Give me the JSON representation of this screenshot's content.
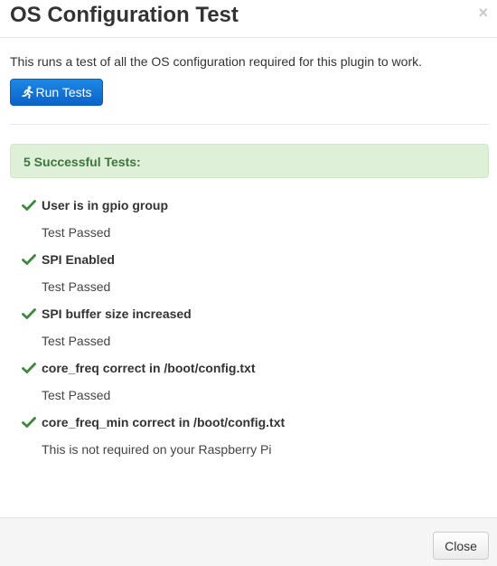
{
  "dialog": {
    "title": "OS Configuration Test",
    "close_glyph": "×",
    "close_icon": "close-icon"
  },
  "intro_text": "This runs a test of all the OS configuration required for this plugin to work.",
  "run_button": {
    "label": "Run Tests",
    "icon": "running-person-icon"
  },
  "summary": {
    "text": "5 Successful Tests:",
    "bg_color": "#dff0d8",
    "text_color": "#3c763d"
  },
  "tests": [
    {
      "name": "User is in gpio group",
      "result": "Test Passed",
      "status": "pass"
    },
    {
      "name": "SPI Enabled",
      "result": "Test Passed",
      "status": "pass"
    },
    {
      "name": "SPI buffer size increased",
      "result": "Test Passed",
      "status": "pass"
    },
    {
      "name": "core_freq correct in /boot/config.txt",
      "result": "Test Passed",
      "status": "pass"
    },
    {
      "name": "core_freq_min correct in /boot/config.txt",
      "result": "This is not required on your Raspberry Pi",
      "status": "pass"
    }
  ],
  "check_color": "#3c8a3c",
  "footer": {
    "close_label": "Close"
  }
}
